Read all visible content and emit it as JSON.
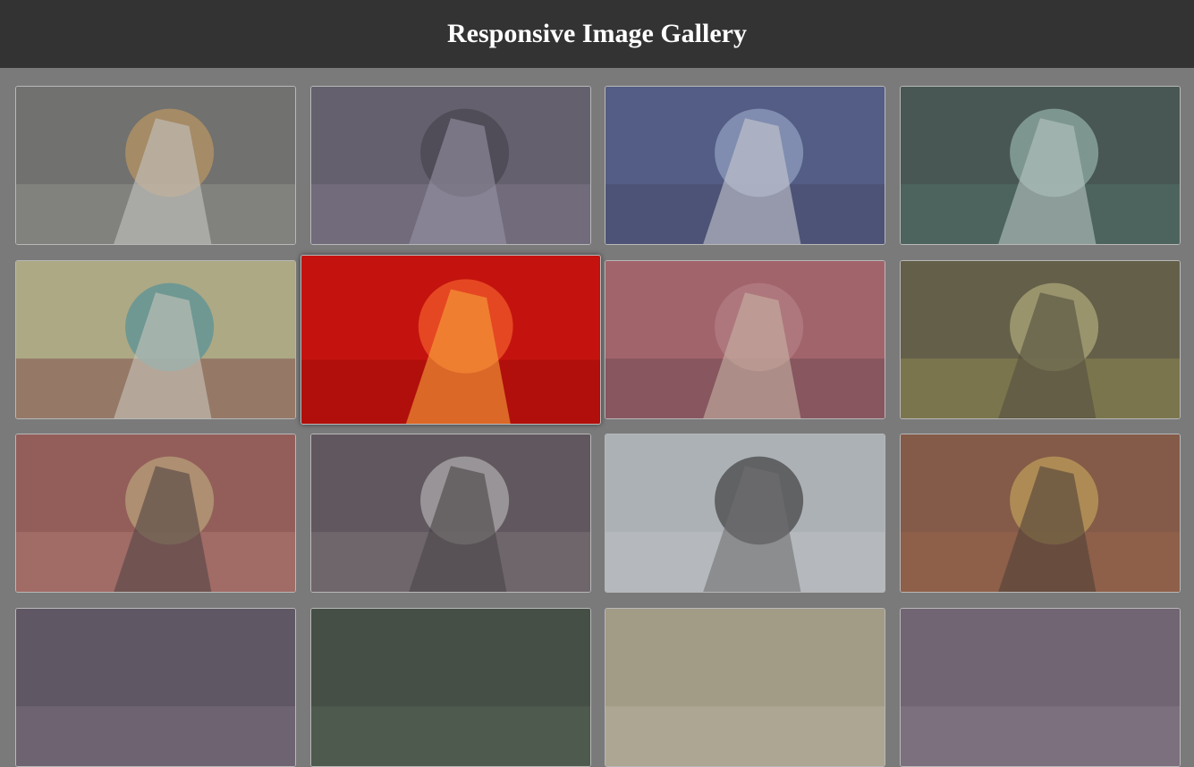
{
  "header": {
    "title": "Responsive Image Gallery"
  },
  "gallery": {
    "images": [
      {
        "name": "white-horse-sun",
        "colors": [
          "#6e6e6a",
          "#9a9a94",
          "#d8a35a",
          "#efefe8"
        ]
      },
      {
        "name": "spider-web",
        "colors": [
          "#5a5368",
          "#7e7590",
          "#322c3e",
          "#a9a2bd"
        ]
      },
      {
        "name": "ice-warrior-moon",
        "colors": [
          "#3f4f8d",
          "#2e3462",
          "#9eb2e4",
          "#f1f3ff"
        ]
      },
      {
        "name": "serpent-goddess",
        "colors": [
          "#2e463f",
          "#3f6a5e",
          "#9fc7bd",
          "#d9efe9"
        ]
      },
      {
        "name": "dragons-yellow",
        "colors": [
          "#c9c38a",
          "#8b3c3a",
          "#4aa0aa",
          "#f2f0e0"
        ]
      },
      {
        "name": "fire-woman-red",
        "colors": [
          "#c4130e",
          "#a20c09",
          "#f05a2a",
          "#f7a33a"
        ],
        "highlight": true
      },
      {
        "name": "wolf-pink-city",
        "colors": [
          "#b85a64",
          "#6e3344",
          "#d1818a",
          "#f1d1b9"
        ]
      },
      {
        "name": "antlered-reaper",
        "colors": [
          "#5a5230",
          "#9a8e3e",
          "#c8c07a",
          "#403a22"
        ]
      },
      {
        "name": "angel-hammer",
        "colors": [
          "#a2504a",
          "#c9756d",
          "#d8b47a",
          "#3d2a28"
        ]
      },
      {
        "name": "crystal-knight",
        "colors": [
          "#544850",
          "#7e7078",
          "#c8c2c6",
          "#2e282c"
        ]
      },
      {
        "name": "horned-queen",
        "colors": [
          "#c8cfd6",
          "#e1e6ea",
          "#2e2e30",
          "#6a6a6e"
        ]
      },
      {
        "name": "sun-god-hands",
        "colors": [
          "#8a4a2e",
          "#a85a34",
          "#e0b04a",
          "#3a2418"
        ]
      },
      {
        "name": "row4-a",
        "colors": [
          "#54465a",
          "#7a6a80"
        ]
      },
      {
        "name": "row4-b",
        "colors": [
          "#2a3a2a",
          "#3f5a3f"
        ]
      },
      {
        "name": "row4-c",
        "colors": [
          "#b9ae8e",
          "#d6cdb0"
        ]
      },
      {
        "name": "row4-d",
        "colors": [
          "#6e5a70",
          "#8c7892"
        ]
      }
    ]
  }
}
